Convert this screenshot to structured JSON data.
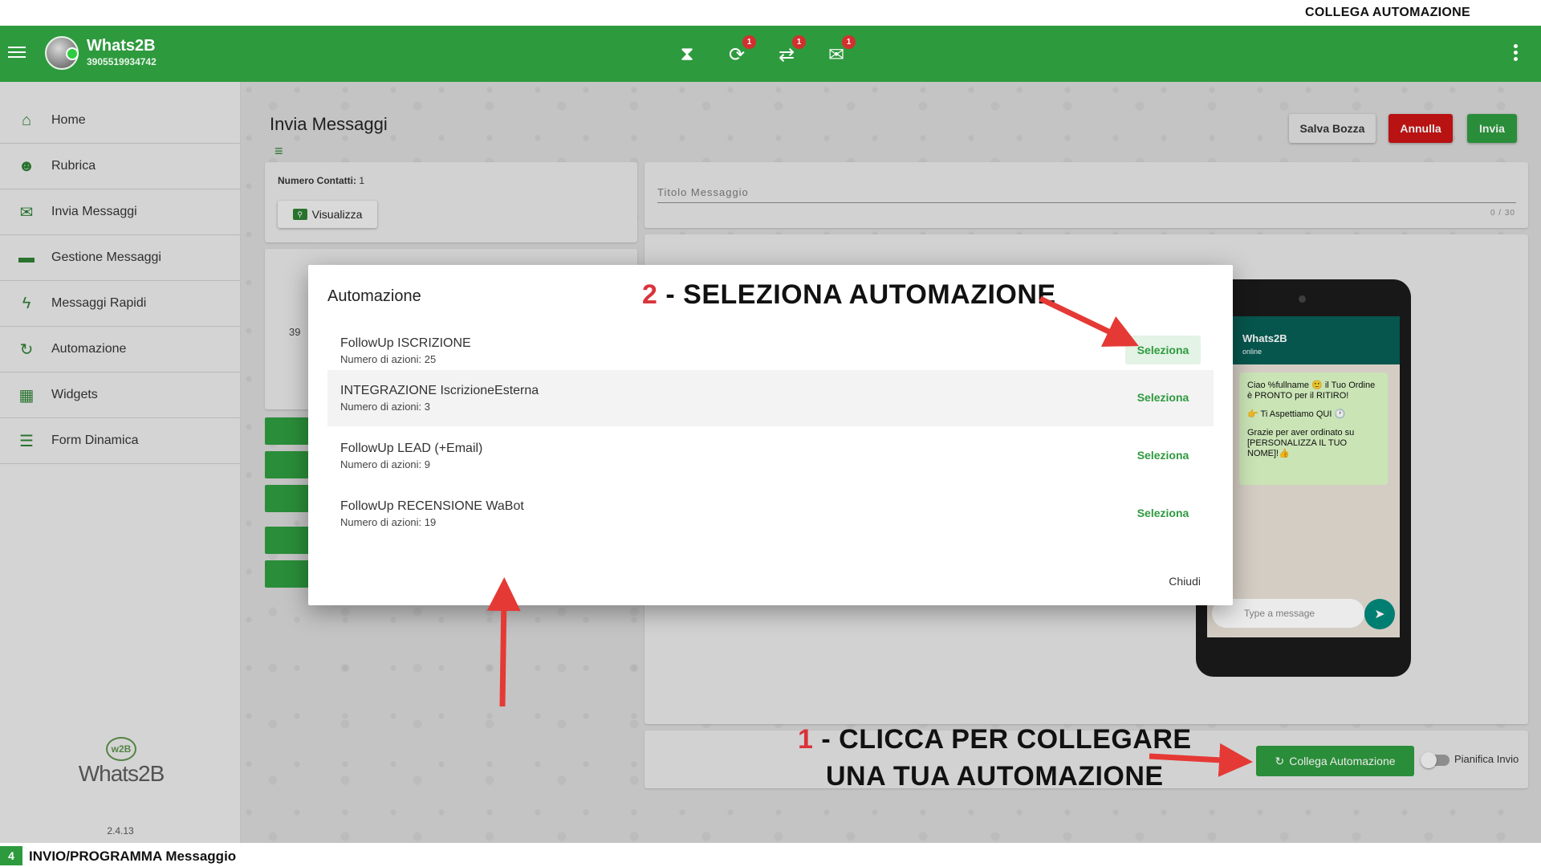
{
  "top_caption": "COLLEGA AUTOMAZIONE",
  "header": {
    "brand_name": "Whats2B",
    "phone": "3905519934742",
    "icons": [
      {
        "name": "hourglass-icon",
        "glyph": "⧗",
        "badge": ""
      },
      {
        "name": "scheduled-icon",
        "glyph": "⟳",
        "badge": "1"
      },
      {
        "name": "sync-icon",
        "glyph": "⇄",
        "badge": "1"
      },
      {
        "name": "send-error-icon",
        "glyph": "✉",
        "badge": "1"
      }
    ]
  },
  "sidebar": {
    "items": [
      {
        "label": "Home",
        "icon": "home-icon"
      },
      {
        "label": "Rubrica",
        "icon": "contacts-icon"
      },
      {
        "label": "Invia Messaggi",
        "icon": "mail-icon"
      },
      {
        "label": "Gestione Messaggi",
        "icon": "folder-icon"
      },
      {
        "label": "Messaggi Rapidi",
        "icon": "bolt-icon"
      },
      {
        "label": "Automazione",
        "icon": "sync-icon"
      },
      {
        "label": "Widgets",
        "icon": "widgets-icon"
      },
      {
        "label": "Form Dinamica",
        "icon": "form-icon"
      }
    ],
    "logo_text": "Whats2B",
    "logo_mark": "w2B",
    "version": "2.4.13"
  },
  "main": {
    "title": "Invia Messaggi",
    "buttons": {
      "draft": "Salva Bozza",
      "cancel": "Annulla",
      "send": "Invia"
    },
    "contacts_label": "Numero Contatti:",
    "contacts_count": "1",
    "view_button": "Visualizza",
    "left_value": "39",
    "message_title_placeholder": "Titolo Messaggio",
    "title_counter": "0 / 30",
    "link_automation_button": "Collega Automazione",
    "schedule_label": "Pianifica Invio"
  },
  "phone_preview": {
    "contact_name": "Whats2B",
    "status": "online",
    "bubble_lines": [
      "Ciao %fullname 🙂 il Tuo Ordine è PRONTO per il RITIRO!",
      "👉 Ti Aspettiamo QUI 🕐",
      "Grazie per aver ordinato su [PERSONALIZZA IL TUO NOME]!👍"
    ],
    "input_placeholder": "Type a message"
  },
  "modal": {
    "title": "Automazione",
    "rows": [
      {
        "name": "FollowUp ISCRIZIONE",
        "meta": "Numero di azioni: 25",
        "action": "Seleziona"
      },
      {
        "name": "INTEGRAZIONE IscrizioneEsterna",
        "meta": "Numero di azioni: 3",
        "action": "Seleziona"
      },
      {
        "name": "FollowUp LEAD (+Email)",
        "meta": "Numero di azioni: 9",
        "action": "Seleziona"
      },
      {
        "name": "FollowUp RECENSIONE WaBot",
        "meta": "Numero di azioni: 19",
        "action": "Seleziona"
      }
    ],
    "close_label": "Chiudi"
  },
  "annotations": {
    "step2_num": "2",
    "step2_text": " - SELEZIONA AUTOMAZIONE",
    "step1_num": "1",
    "step1_line1": " - CLICCA PER COLLEGARE",
    "step1_line2": "UNA TUA AUTOMAZIONE"
  },
  "footer": {
    "page_number": "4",
    "text": "INVIO/PROGRAMMA Messaggio"
  },
  "colors": {
    "brand_green": "#2e9a3e",
    "cancel_red": "#c81414",
    "annotation_red": "#d9343a"
  }
}
